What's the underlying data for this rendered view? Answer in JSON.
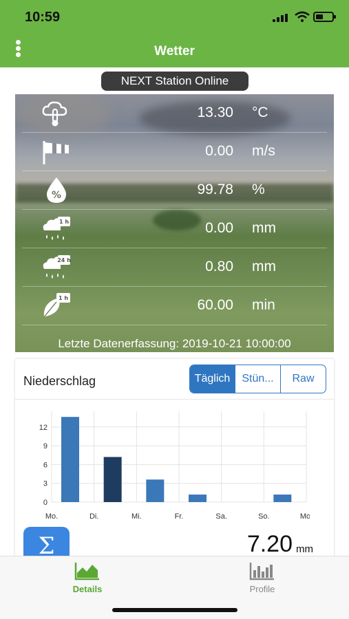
{
  "status_bar": {
    "time": "10:59"
  },
  "header": {
    "title": "Wetter"
  },
  "station_status": "NEXT Station Online",
  "measurements": [
    {
      "icon": "thermometer-cloud-icon",
      "value": "13.30",
      "unit": "°C"
    },
    {
      "icon": "windsock-icon",
      "value": "0.00",
      "unit": "m/s"
    },
    {
      "icon": "humidity-drop-icon",
      "value": "99.78",
      "unit": "%"
    },
    {
      "icon": "rain-1h-icon",
      "icon_label": "1 h",
      "value": "0.00",
      "unit": "mm"
    },
    {
      "icon": "rain-24h-icon",
      "icon_label": "24 h",
      "value": "0.80",
      "unit": "mm"
    },
    {
      "icon": "leaf-wetness-icon",
      "icon_label": "1 h",
      "value": "60.00",
      "unit": "min"
    }
  ],
  "last_update": "Letzte Datenerfassung: 2019-10-21 10:00:00",
  "chart_card": {
    "title": "Niederschlag",
    "segments": [
      "Täglich",
      "Stün...",
      "Raw"
    ],
    "selected_segment": "Täglich"
  },
  "chart_data": {
    "type": "bar",
    "categories": [
      "Mo.",
      "Di.",
      "Mi.",
      "Fr.",
      "Sa.",
      "So.",
      "Mo."
    ],
    "values": [
      13.6,
      7.2,
      3.6,
      1.2,
      0,
      1.2,
      0
    ],
    "highlight_index": 1,
    "yticks": [
      0,
      3,
      6,
      9,
      12
    ],
    "ylim": [
      0,
      14.5
    ],
    "grid": true,
    "colors": {
      "bar": "#3a78b8",
      "highlight": "#1e3c60"
    }
  },
  "summary": {
    "symbol": "Σ",
    "value": "7.20",
    "unit": "mm"
  },
  "tabs": [
    {
      "label": "Details",
      "icon": "area-chart-icon",
      "active": true
    },
    {
      "label": "Profile",
      "icon": "bar-chart-icon",
      "active": false
    }
  ]
}
